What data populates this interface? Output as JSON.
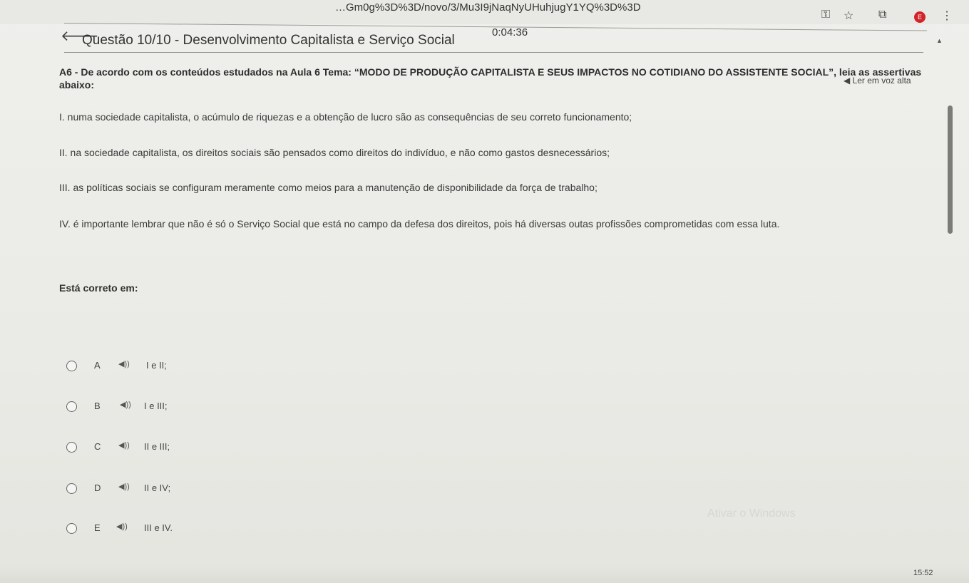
{
  "browser": {
    "url": "…Gm0g%3D%3D/novo/3/Mu3I9jNaqNyUHuhjugY1YQ%3D%3D",
    "key_icon": "key-icon",
    "star_icon": "star-icon",
    "extension_icon": "extension-icon",
    "profile_initial": "E",
    "menu_icon": "more-vert-icon"
  },
  "header": {
    "timer": "0:04:36",
    "title": "Questão 10/10 - Desenvolvimento Capitalista e Serviço Social"
  },
  "read_aloud": "◀ Ler em voz alta",
  "question": {
    "heading": "A6 - De acordo com os conteúdos estudados na Aula 6  Tema: “MODO DE PRODUÇÃO CAPITALISTA E SEUS IMPACTOS NO COTIDIANO DO ASSISTENTE SOCIAL”, leia as assertivas abaixo:",
    "statements": [
      "I. numa sociedade capitalista, o acúmulo de riquezas e a obtenção de lucro são as consequências de seu correto funcionamento;",
      "II. na sociedade capitalista, os direitos sociais são pensados como direitos do indivíduo, e não como gastos desnecessários;",
      "III. as políticas sociais se configuram meramente como meios para a manutenção de disponibilidade da força de trabalho;",
      "IV. é importante lembrar que não é só o Serviço Social que está no campo da defesa dos direitos, pois há diversas outas profissões comprometidas com essa luta."
    ],
    "prompt": "Está correto em:"
  },
  "options": [
    {
      "letter": "A",
      "text": "I e II;"
    },
    {
      "letter": "B",
      "text": "I e III;"
    },
    {
      "letter": "C",
      "text": "II e III;"
    },
    {
      "letter": "D",
      "text": "II e IV;"
    },
    {
      "letter": "E",
      "text": "III e IV."
    }
  ],
  "watermark": "Ativar o Windows",
  "clock": "15:52"
}
